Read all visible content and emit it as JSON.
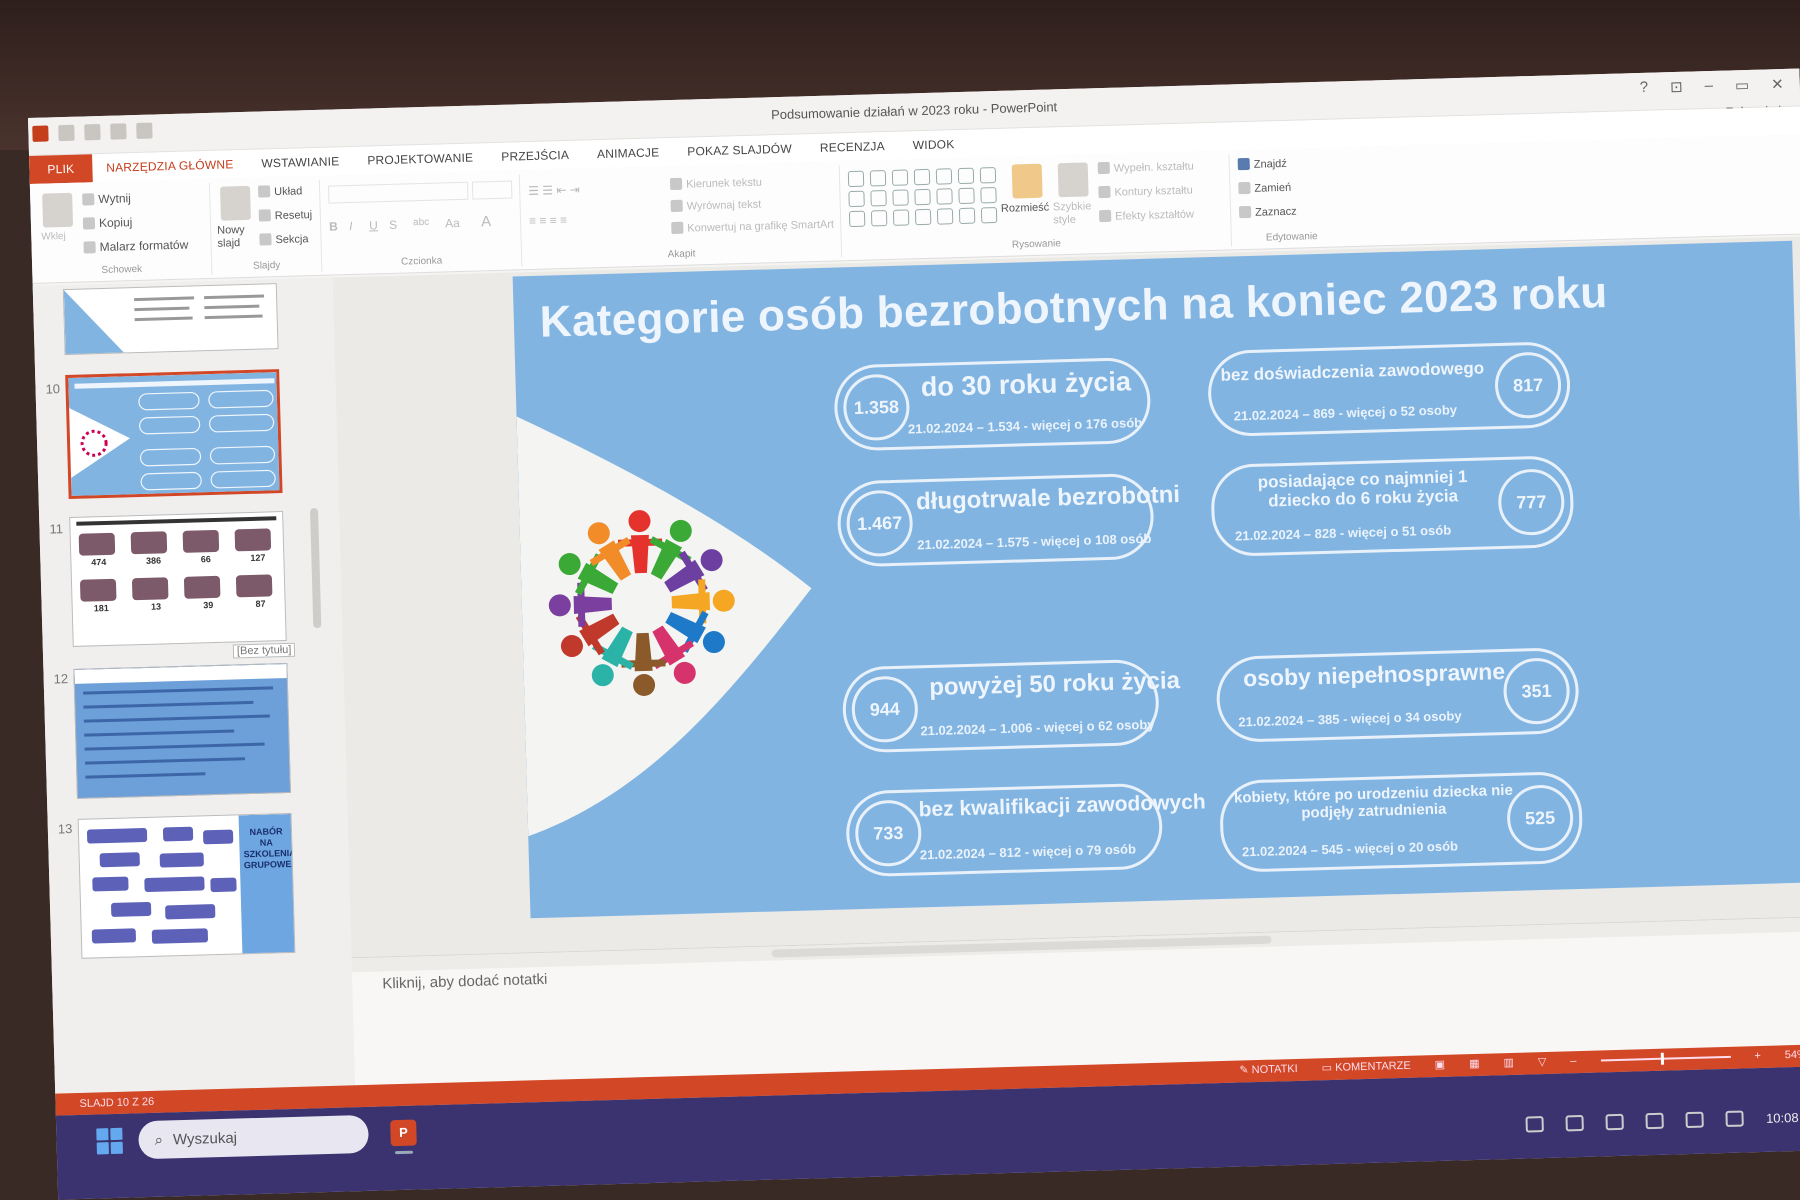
{
  "window": {
    "title": "Podsumowanie działań w 2023 roku - PowerPoint",
    "signin": "Zaloguj się",
    "controls": [
      "?",
      "⊡",
      "–",
      "▭",
      "✕"
    ]
  },
  "ribbon_tabs": [
    "PLIK",
    "NARZĘDZIA GŁÓWNE",
    "WSTAWIANIE",
    "PROJEKTOWANIE",
    "PRZEJŚCIA",
    "ANIMACJE",
    "POKAZ SLAJDÓW",
    "RECENZJA",
    "WIDOK"
  ],
  "ribbon": {
    "clipboard": {
      "paste": "Wklej",
      "cut": "Wytnij",
      "copy": "Kopiuj",
      "format_painter": "Malarz formatów",
      "label": "Schowek"
    },
    "slides": {
      "new_slide": "Nowy slajd",
      "layout": "Układ",
      "reset": "Resetuj",
      "section": "Sekcja",
      "label": "Slajdy"
    },
    "font": {
      "label": "Czcionka",
      "bold": "B",
      "italic": "I",
      "underline": "U",
      "strike": "S",
      "abc": "abc",
      "aa": "Aa",
      "a": "A"
    },
    "paragraph": {
      "text_direction": "Kierunek tekstu",
      "align_text": "Wyrównaj tekst",
      "smartart": "Konwertuj na grafikę SmartArt",
      "label": "Akapit"
    },
    "drawing": {
      "arrange": "Rozmieść",
      "quick_styles": "Szybkie style",
      "fill": "Wypełn. kształtu",
      "outline": "Kontury kształtu",
      "effects": "Efekty kształtów",
      "label": "Rysowanie"
    },
    "editing": {
      "find": "Znajdź",
      "replace": "Zamień",
      "select": "Zaznacz",
      "label": "Edytowanie"
    }
  },
  "thumbnails": {
    "numbers": [
      "10",
      "11",
      "12",
      "13"
    ],
    "tooltip": "[Bez tytułu]",
    "t11_values": [
      "474",
      "386",
      "66",
      "127",
      "181",
      "13",
      "39",
      "87"
    ],
    "t13_text": "NABÓR NA SZKOLENIA GRUPOWE"
  },
  "slide": {
    "title": "Kategorie osób bezrobotnych na koniec 2023 roku",
    "cards": [
      {
        "value": "1.358",
        "label": "do 30 roku życia",
        "note": "21.02.2024 – 1.534 - więcej o 176 osób"
      },
      {
        "value": "817",
        "label": "bez doświadczenia zawodowego",
        "note": "21.02.2024 – 869 - więcej o 52 osoby"
      },
      {
        "value": "1.467",
        "label": "długotrwale bezrobotni",
        "note": "21.02.2024 – 1.575 - więcej o 108 osób"
      },
      {
        "value": "777",
        "label": "posiadające co najmniej 1 dziecko do 6 roku życia",
        "note": "21.02.2024 – 828 - więcej o 51 osób"
      },
      {
        "value": "944",
        "label": "powyżej 50 roku życia",
        "note": "21.02.2024 – 1.006 - więcej o 62 osoby"
      },
      {
        "value": "351",
        "label": "osoby niepełnosprawne",
        "note": "21.02.2024 – 385 - więcej o 34 osoby"
      },
      {
        "value": "733",
        "label": "bez kwalifikacji zawodowych",
        "note": "21.02.2024 – 812 - więcej o 79 osób"
      },
      {
        "value": "525",
        "label": "kobiety, które po urodzeniu dziecka nie podjęły zatrudnienia",
        "note": "21.02.2024 – 545 - więcej o 20 osób"
      }
    ],
    "people_colors": [
      "#e5322d",
      "#3aa935",
      "#6c3fa0",
      "#f5a623",
      "#1e7ac8",
      "#d6336c",
      "#8b5a2b",
      "#2bb3a8",
      "#c0392b",
      "#7b3fa0",
      "#3aa935",
      "#f28c28"
    ]
  },
  "notes": {
    "placeholder": "Kliknij, aby dodać notatki"
  },
  "statusbar": {
    "slide_info": "SLAJD 10 Z 26",
    "notes_btn": "NOTATKI",
    "comments_btn": "KOMENTARZE",
    "zoom": "54%"
  },
  "taskbar": {
    "search_placeholder": "Wyszukaj",
    "time": "10:08"
  }
}
